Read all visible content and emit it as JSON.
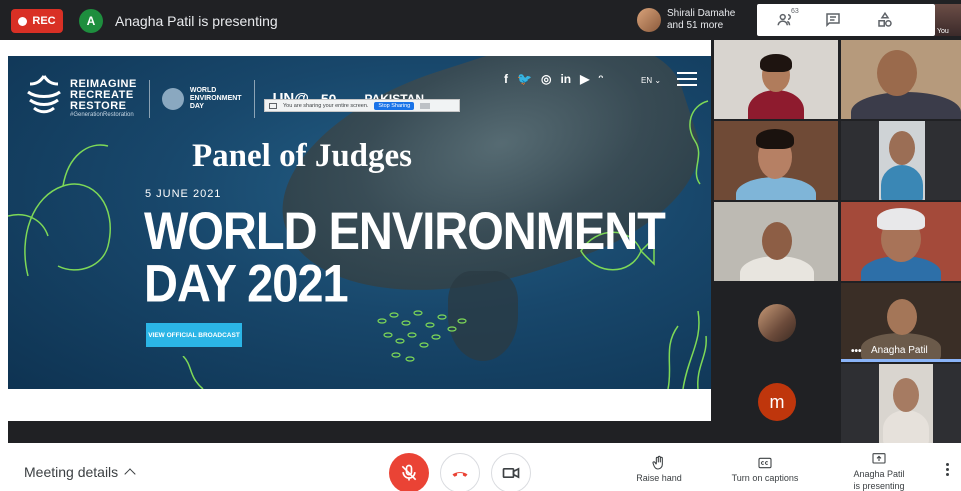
{
  "topbar": {
    "rec_label": "REC",
    "presenter_initial": "A",
    "presenting_text": "Anagha Patil is presenting",
    "people_chip": {
      "line1": "Shirali Damahe",
      "line2": "and 51 more"
    },
    "people_count": "63",
    "you_label": "You"
  },
  "slide": {
    "brand_lines": [
      "REIMAGINE",
      "RECREATE",
      "RESTORE"
    ],
    "brand_tag": "#GenerationRestoration",
    "wed_lines": [
      "WORLD",
      "ENVIRONMENT",
      "DAY"
    ],
    "un_logo": "UN@",
    "un_50": "50",
    "pakistan": "PAKISTAN",
    "social": [
      "f",
      "🐦",
      "◎",
      "in",
      "▶",
      "ᵔ"
    ],
    "lang": "EN ⌄",
    "share_notice": "You are sharing your entire screen.",
    "stop_sharing": "Stop Sharing",
    "panel_title": "Panel of Judges",
    "date": "5 JUNE 2021",
    "title_line1": "WORLD ENVIRONMENT",
    "title_line2": "DAY 2021",
    "broadcast_button": "VIEW OFFICIAL BROADCAST"
  },
  "participants": {
    "named_tile": "Anagha Patil",
    "named_dots": "•••",
    "m_initial": "m"
  },
  "bottombar": {
    "meeting_details": "Meeting details",
    "raise_hand": "Raise hand",
    "captions": "Turn on captions",
    "presenting_line1": "Anagha Patil",
    "presenting_line2": "is presenting"
  },
  "colors": {
    "topbar_bg": "#202124",
    "rec_red": "#d93025",
    "mic_off_red": "#ea4335",
    "broadcast_blue": "#2bb5e6",
    "active_speaker": "#8ab4f8",
    "avatar_m": "#bf360c"
  }
}
